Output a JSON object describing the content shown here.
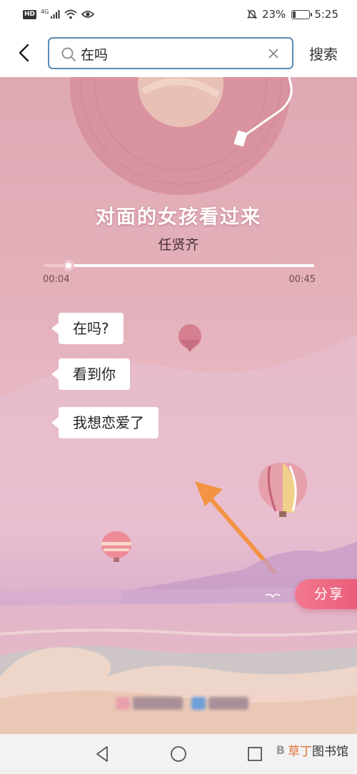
{
  "status_bar": {
    "hd_badge": "HD",
    "network": "4G",
    "battery_percent": "23%",
    "battery_level": 0.23,
    "time": "5:25"
  },
  "header": {
    "search": {
      "value": "在吗"
    },
    "search_button_label": "搜索"
  },
  "player": {
    "song_title": "对面的女孩看过来",
    "artist": "任贤齐",
    "current_time": "00:04",
    "total_time": "00:45",
    "progress_fraction": 0.09
  },
  "lyrics_bubbles": [
    {
      "text": "在吗?"
    },
    {
      "text": "看到你"
    },
    {
      "text": "我想恋爱了"
    }
  ],
  "share_button_label": "分享",
  "watermark": {
    "text_orange": "草丁",
    "text_dark": "图书馆"
  },
  "colors": {
    "search_border": "#5b8bb4",
    "share_button": "#e95a76",
    "arrow": "#f29444",
    "watermark_accent": "#e0743a"
  }
}
